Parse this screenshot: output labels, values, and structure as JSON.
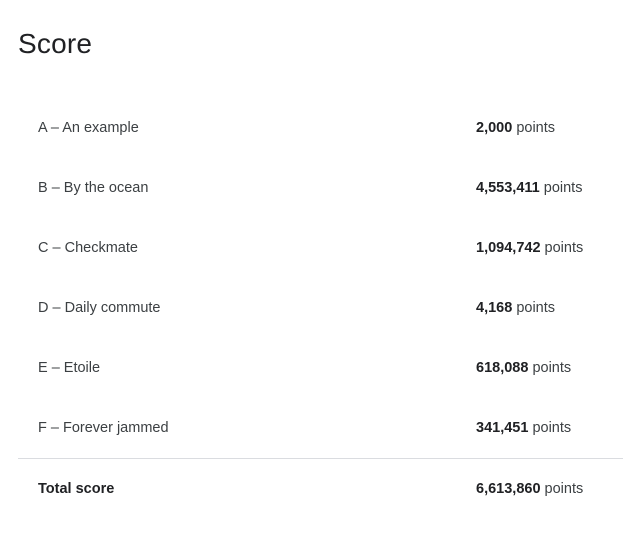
{
  "page": {
    "title": "Score"
  },
  "rows": [
    {
      "label": "A – An example",
      "value": "2,000",
      "unit": "points"
    },
    {
      "label": "B – By the ocean",
      "value": "4,553,411",
      "unit": "points"
    },
    {
      "label": "C – Checkmate",
      "value": "1,094,742",
      "unit": "points"
    },
    {
      "label": "D – Daily commute",
      "value": "4,168",
      "unit": "points"
    },
    {
      "label": "E – Etoile",
      "value": "618,088",
      "unit": "points"
    },
    {
      "label": "F – Forever jammed",
      "value": "341,451",
      "unit": "points"
    }
  ],
  "total": {
    "label": "Total score",
    "value": "6,613,860",
    "unit": "points"
  }
}
